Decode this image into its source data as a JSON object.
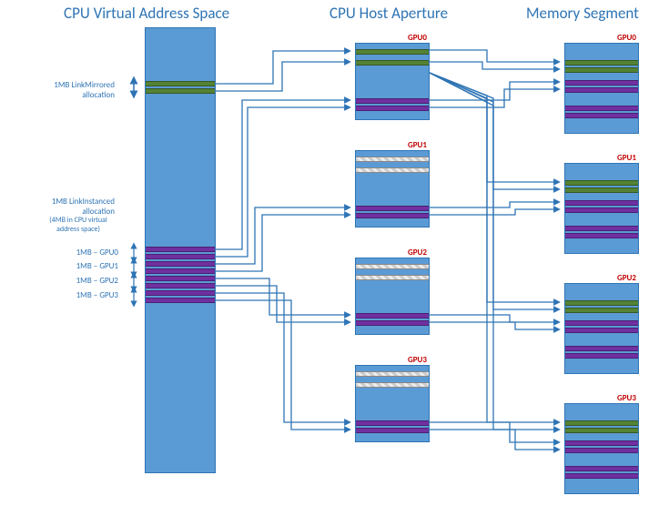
{
  "titles": {
    "cva": "CPU Virtual Address Space",
    "cha": "CPU Host Aperture",
    "ms": "Memory Segment"
  },
  "labels": {
    "mirrored": "1MB LinkMirrored\nallocation",
    "instanced_title": "1MB LinkInstanced\nallocation",
    "instanced_note": "(4MB in CPU virtual\naddress space)",
    "g0": "1MB – GPU0",
    "g1": "1MB – GPU1",
    "g2": "1MB – GPU2",
    "g3": "1MB – GPU3",
    "gpu0": "GPU0",
    "gpu1": "GPU1",
    "gpu2": "GPU2",
    "gpu3": "GPU3"
  },
  "chart_data": {
    "type": "diagram",
    "columns": [
      {
        "name": "CPU Virtual Address Space",
        "allocations": [
          {
            "type": "LinkMirrored",
            "size_mb": 1,
            "stripes": [
              "green",
              "green"
            ]
          },
          {
            "type": "LinkInstanced",
            "size_mb": 4,
            "per_gpu_mb": 1,
            "stripes": [
              "purple:GPU0",
              "purple:GPU0",
              "purple:GPU1",
              "purple:GPU1",
              "purple:GPU2",
              "purple:GPU2",
              "purple:GPU3",
              "purple:GPU3"
            ]
          }
        ]
      },
      {
        "name": "CPU Host Aperture",
        "gpus": [
          {
            "id": "GPU0",
            "stripes": [
              "green",
              "green",
              "purple",
              "purple"
            ]
          },
          {
            "id": "GPU1",
            "stripes": [
              "hatch",
              "hatch",
              "purple",
              "purple"
            ]
          },
          {
            "id": "GPU2",
            "stripes": [
              "hatch",
              "hatch",
              "purple",
              "purple"
            ]
          },
          {
            "id": "GPU3",
            "stripes": [
              "hatch",
              "hatch",
              "purple",
              "purple"
            ]
          }
        ]
      },
      {
        "name": "Memory Segment",
        "gpus": [
          {
            "id": "GPU0",
            "stripes": [
              "green",
              "green",
              "purple",
              "purple",
              "purple",
              "purple"
            ]
          },
          {
            "id": "GPU1",
            "stripes": [
              "green",
              "green",
              "purple",
              "purple",
              "purple",
              "purple"
            ]
          },
          {
            "id": "GPU2",
            "stripes": [
              "green",
              "green",
              "purple",
              "purple",
              "purple",
              "purple"
            ]
          },
          {
            "id": "GPU3",
            "stripes": [
              "green",
              "green",
              "purple",
              "purple",
              "purple",
              "purple"
            ]
          }
        ]
      }
    ],
    "mappings_left_to_mid": [
      {
        "from": "mirrored",
        "to": "GPU0.green"
      },
      {
        "from": "instanced.GPU0",
        "to": "GPU0.purple"
      },
      {
        "from": "instanced.GPU1",
        "to": "GPU1.purple"
      },
      {
        "from": "instanced.GPU2",
        "to": "GPU2.purple"
      },
      {
        "from": "instanced.GPU3",
        "to": "GPU3.purple"
      }
    ],
    "mappings_mid_to_right": [
      {
        "from": "GPU0.green",
        "to": [
          "GPU0.green",
          "GPU1.green",
          "GPU2.green",
          "GPU3.green"
        ]
      },
      {
        "from": "GPU0.purple",
        "to": [
          "GPU0.purple"
        ]
      },
      {
        "from": "GPU1.purple",
        "to": [
          "GPU1.purple"
        ]
      },
      {
        "from": "GPU2.purple",
        "to": [
          "GPU2.purple"
        ]
      },
      {
        "from": "GPU3.purple",
        "to": [
          "GPU3.purple"
        ]
      }
    ]
  }
}
